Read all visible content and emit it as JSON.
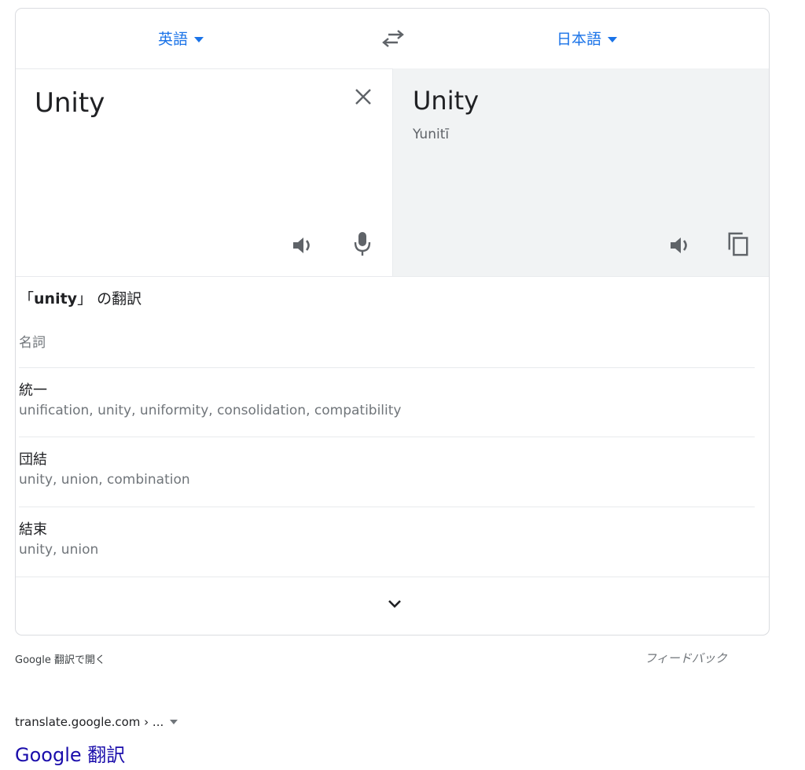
{
  "translator": {
    "source_language": "英語",
    "target_language": "日本語",
    "source_text": "Unity",
    "translated_text": "Unity",
    "romanization": "Yunitī",
    "icons": {
      "swap": "swap-arrows-icon",
      "clear": "close-icon",
      "speak": "speaker-icon",
      "mic": "microphone-icon",
      "copy": "copy-icon",
      "expand": "chevron-down-icon"
    }
  },
  "dictionary": {
    "title_open": "「",
    "title_word": "unity",
    "title_close": "」",
    "title_suffix": " の翻訳",
    "part_of_speech": "名詞",
    "entries": [
      {
        "word": "統一",
        "synonyms": "unification, unity, uniformity, consolidation, compatibility"
      },
      {
        "word": "団結",
        "synonyms": "unity, union, combination"
      },
      {
        "word": "結束",
        "synonyms": "unity, union"
      }
    ]
  },
  "footer": {
    "open_link": "Google 翻訳で開く",
    "feedback": "フィードバック"
  },
  "search_result": {
    "url": "translate.google.com › ...",
    "title": "Google 翻訳"
  },
  "colors": {
    "accent": "#1a73e8",
    "target_pane_bg": "#f1f3f4",
    "link": "#1a0dab",
    "secondary_text": "#70757a"
  }
}
